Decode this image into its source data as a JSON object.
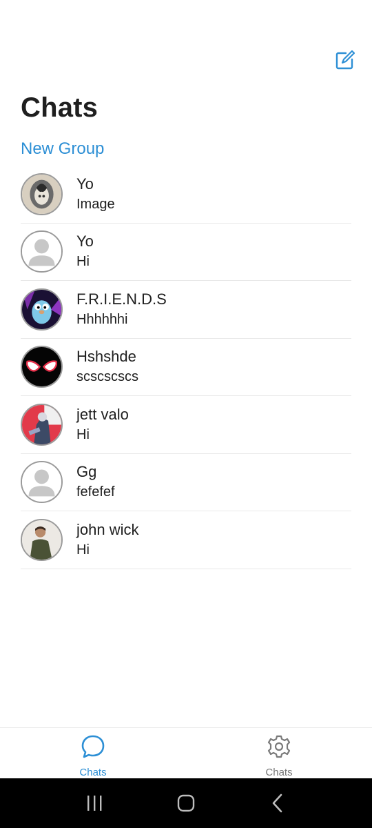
{
  "header": {
    "title": "Chats",
    "new_group_label": "New Group",
    "compose_icon": "compose-icon"
  },
  "chats": [
    {
      "name": "Yo",
      "message": "Image",
      "avatar": "photo"
    },
    {
      "name": "Yo",
      "message": "Hi",
      "avatar": "placeholder"
    },
    {
      "name": "F.R.I.E.N.D.S",
      "message": "Hhhhhhi",
      "avatar": "gopher"
    },
    {
      "name": "Hshshde",
      "message": "scscscscs",
      "avatar": "spider-mask"
    },
    {
      "name": "jett valo",
      "message": "Hi",
      "avatar": "character"
    },
    {
      "name": "Gg",
      "message": "fefefef",
      "avatar": "placeholder"
    },
    {
      "name": "john wick",
      "message": "Hi",
      "avatar": "person"
    }
  ],
  "bottom_nav": [
    {
      "label": "Chats",
      "icon": "chat-bubble-icon",
      "active": true
    },
    {
      "label": "Chats",
      "icon": "gear-icon",
      "active": false
    }
  ],
  "colors": {
    "accent": "#2d8fd5",
    "text": "#1f1f1f",
    "divider": "#e8e8e8",
    "system_bar": "#000000"
  }
}
